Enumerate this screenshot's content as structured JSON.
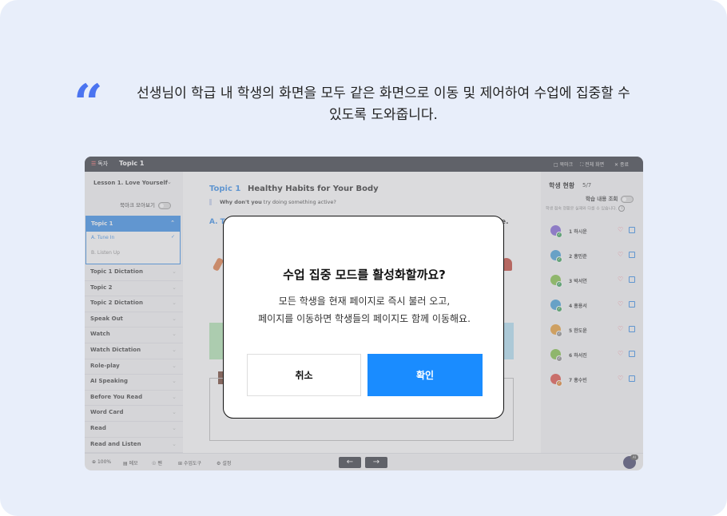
{
  "caption": {
    "line1": "선생님이 학급 내 학생의 화면을 모두 같은 화면으로 이동 및 제어하여 수업에 집중할 수",
    "line2": "있도록 도와줍니다."
  },
  "topbar": {
    "logo_text": "독자",
    "title": "Topic 1",
    "bookmark": "북마크",
    "fullscreen": "전체 화면",
    "close": "종료"
  },
  "sidebar": {
    "lesson": "Lesson 1. Love Yourself",
    "bookmark_toggle_label": "북마크 모아보기",
    "open_topic": "Topic 1",
    "open_sub": [
      "A. Tune In",
      "B. Listen Up"
    ],
    "items": [
      "Topic 1 Dictation",
      "Topic 2",
      "Topic 2 Dictation",
      "Speak Out",
      "Watch",
      "Watch Dictation",
      "Role-play",
      "AI Speaking",
      "Before You Read",
      "Word Card",
      "Read",
      "Read and Listen"
    ]
  },
  "main": {
    "topic_label": "Topic 1",
    "title": "Healthy Habits for Your Body",
    "subtitle_bold": "Why don't you",
    "subtitle_rest": " try doing something active?",
    "section_a": "A. T",
    "section_end": "e."
  },
  "right_panel": {
    "title": "학생 현황",
    "count": "5/7",
    "toggle_label": "학습 내용 조회",
    "note": "학생 접속 현황은 실제와 다를 수 있습니다.",
    "students": [
      {
        "name": "1 하시운",
        "color": "#7b5cd6",
        "status": "#2e9e4f"
      },
      {
        "name": "2 홍민준",
        "color": "#3a9bd8",
        "status": "#2e9e4f"
      },
      {
        "name": "3 박서연",
        "color": "#7cbf3d",
        "status": "#2e9e4f"
      },
      {
        "name": "4 홍용서",
        "color": "#3a9bd8",
        "status": "#2e9e4f"
      },
      {
        "name": "5 한도윤",
        "color": "#e89a2c",
        "status": "#888888"
      },
      {
        "name": "6 하서진",
        "color": "#7cbf3d",
        "status": "#888888"
      },
      {
        "name": "7 홍수빈",
        "color": "#e0463b",
        "status": "#e07a1f"
      }
    ]
  },
  "bottombar": {
    "zoom": "100%",
    "memo": "메모",
    "home": "펜",
    "tools": "수업도구",
    "settings": "설정",
    "prev": "←",
    "next": "→",
    "badge": "AI"
  },
  "modal": {
    "title": "수업 집중 모드를 활성화할까요?",
    "body_line1": "모든 학생을 현재 페이지로 즉시 불러 오고,",
    "body_line2": "페이지를 이동하면 학생들의 페이지도 함께 이동해요.",
    "cancel": "취소",
    "confirm": "확인"
  }
}
